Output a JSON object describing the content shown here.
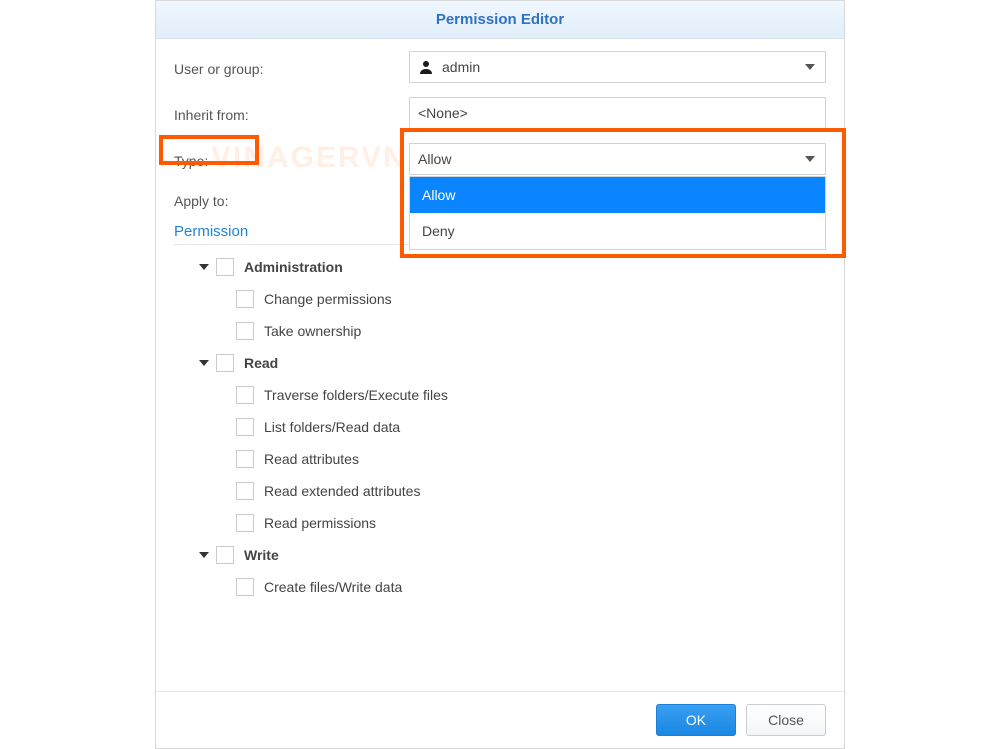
{
  "title": "Permission Editor",
  "fields": {
    "user_or_group": {
      "label": "User or group:",
      "value": "admin"
    },
    "inherit_from": {
      "label": "Inherit from:",
      "value": "<None>"
    },
    "type": {
      "label": "Type:",
      "value": "Allow",
      "options": [
        "Allow",
        "Deny"
      ],
      "selected_index": 0
    },
    "apply_to": {
      "label": "Apply to:"
    }
  },
  "permission_header": "Permission",
  "tree": [
    {
      "label": "Administration",
      "bold": true,
      "expandable": true,
      "children": [
        "Change permissions",
        "Take ownership"
      ]
    },
    {
      "label": "Read",
      "bold": true,
      "expandable": true,
      "children": [
        "Traverse folders/Execute files",
        "List folders/Read data",
        "Read attributes",
        "Read extended attributes",
        "Read permissions"
      ]
    },
    {
      "label": "Write",
      "bold": true,
      "expandable": true,
      "children": [
        "Create files/Write data"
      ]
    }
  ],
  "buttons": {
    "ok": "OK",
    "close": "Close"
  },
  "watermark": "VINAGERVN"
}
